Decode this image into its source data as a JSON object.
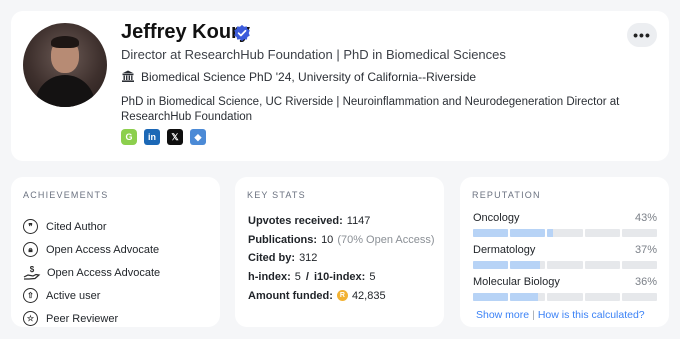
{
  "profile": {
    "name": "Jeffrey Koury",
    "headline": "Director at ResearchHub Foundation | PhD in Biomedical Sciences",
    "education": "Biomedical Science PhD '24, University of California--Riverside",
    "bio": "PhD in Biomedical Science, UC Riverside | Neuroinflammation and Neurodegeneration Director at ResearchHub Foundation",
    "menu_label": "•••",
    "socials": [
      {
        "icon": "google-scholar-icon",
        "label": "G"
      },
      {
        "icon": "linkedin-icon",
        "label": "in"
      },
      {
        "icon": "x-icon",
        "label": "𝕏"
      },
      {
        "icon": "orcid-icon",
        "label": "◆"
      }
    ],
    "accent_verified": "#3b5bdb"
  },
  "achievements": {
    "title": "ACHIEVEMENTS",
    "items": [
      {
        "icon": "quote-icon",
        "label": "Cited Author"
      },
      {
        "icon": "lock-icon",
        "label": "Open Access Advocate"
      },
      {
        "icon": "hand-money-icon",
        "label": "Open Access Advocate"
      },
      {
        "icon": "arrow-up-icon",
        "label": "Active user"
      },
      {
        "icon": "star-icon",
        "label": "Peer Reviewer"
      }
    ]
  },
  "stats": {
    "title": "KEY STATS",
    "upvotes_label": "Upvotes received:",
    "upvotes_value": "1147",
    "publications_label": "Publications:",
    "publications_value": "10",
    "publications_note": "(70% Open Access)",
    "cited_label": "Cited by:",
    "cited_value": "312",
    "hindex_label": "h-index:",
    "hindex_value": "5",
    "separator": "/",
    "i10_label": "i10-index:",
    "i10_value": "5",
    "funded_label": "Amount funded:",
    "funded_value": "42,835",
    "coin_color": "#f2b233"
  },
  "reputation": {
    "title": "REPUTATION",
    "items": [
      {
        "field": "Oncology",
        "percent": "43%",
        "fraction": 0.43
      },
      {
        "field": "Dermatology",
        "percent": "37%",
        "fraction": 0.37
      },
      {
        "field": "Molecular Biology",
        "percent": "36%",
        "fraction": 0.36
      }
    ],
    "show_more": "Show more",
    "link_sep": "|",
    "how_calculated": "How is this calculated?",
    "bar_fill_color": "#b7d3f6",
    "bar_empty_color": "#e6e8eb"
  }
}
